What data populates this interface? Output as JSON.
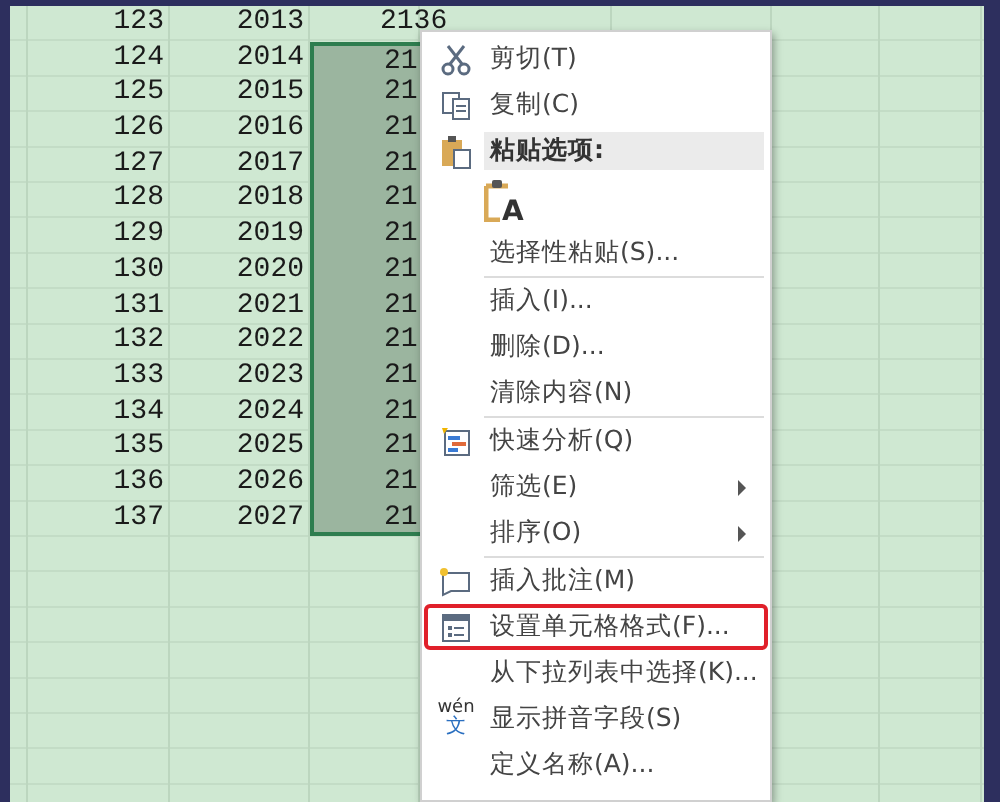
{
  "sheet": {
    "rows": [
      {
        "cells": [
          "123",
          "2013",
          "2136"
        ],
        "selected": false
      },
      {
        "cells": [
          "124",
          "2014",
          "21"
        ],
        "selected": true
      },
      {
        "cells": [
          "125",
          "2015",
          "21"
        ],
        "selected": true
      },
      {
        "cells": [
          "126",
          "2016",
          "21"
        ],
        "selected": true
      },
      {
        "cells": [
          "127",
          "2017",
          "21"
        ],
        "selected": true
      },
      {
        "cells": [
          "128",
          "2018",
          "21"
        ],
        "selected": true
      },
      {
        "cells": [
          "129",
          "2019",
          "21"
        ],
        "selected": true
      },
      {
        "cells": [
          "130",
          "2020",
          "21"
        ],
        "selected": true
      },
      {
        "cells": [
          "131",
          "2021",
          "21"
        ],
        "selected": true
      },
      {
        "cells": [
          "132",
          "2022",
          "21"
        ],
        "selected": true
      },
      {
        "cells": [
          "133",
          "2023",
          "21"
        ],
        "selected": true
      },
      {
        "cells": [
          "134",
          "2024",
          "21"
        ],
        "selected": true
      },
      {
        "cells": [
          "135",
          "2025",
          "21"
        ],
        "selected": true
      },
      {
        "cells": [
          "136",
          "2026",
          "21"
        ],
        "selected": true
      },
      {
        "cells": [
          "137",
          "2027",
          "21"
        ],
        "selected": true
      }
    ]
  },
  "context_menu": {
    "items": [
      {
        "kind": "item",
        "label": "剪切(T)",
        "submenu": false,
        "outlined": false
      },
      {
        "kind": "item",
        "label": "复制(C)",
        "submenu": false,
        "outlined": false
      },
      {
        "kind": "header",
        "label": "粘贴选项:"
      },
      {
        "kind": "paste-options",
        "icon_char": "A"
      },
      {
        "kind": "item",
        "label": "选择性粘贴(S)...",
        "submenu": false,
        "outlined": false
      },
      {
        "kind": "separator"
      },
      {
        "kind": "item",
        "label": "插入(I)...",
        "submenu": false,
        "outlined": false
      },
      {
        "kind": "item",
        "label": "删除(D)...",
        "submenu": false,
        "outlined": false
      },
      {
        "kind": "item",
        "label": "清除内容(N)",
        "submenu": false,
        "outlined": false
      },
      {
        "kind": "separator"
      },
      {
        "kind": "item",
        "label": "快速分析(Q)",
        "submenu": false,
        "outlined": false
      },
      {
        "kind": "item",
        "label": "筛选(E)",
        "submenu": true,
        "outlined": false
      },
      {
        "kind": "item",
        "label": "排序(O)",
        "submenu": true,
        "outlined": false
      },
      {
        "kind": "separator"
      },
      {
        "kind": "item",
        "label": "插入批注(M)",
        "submenu": false,
        "outlined": false
      },
      {
        "kind": "item",
        "label": "设置单元格格式(F)...",
        "submenu": false,
        "outlined": true
      },
      {
        "kind": "item",
        "label": "从下拉列表中选择(K)...",
        "submenu": false,
        "outlined": false
      },
      {
        "kind": "item",
        "label": "显示拼音字段(S)",
        "icon_text": "wén",
        "icon_char": "文",
        "submenu": false,
        "outlined": false
      },
      {
        "kind": "item",
        "label": "定义名称(A)...",
        "submenu": false,
        "outlined": false
      }
    ]
  }
}
